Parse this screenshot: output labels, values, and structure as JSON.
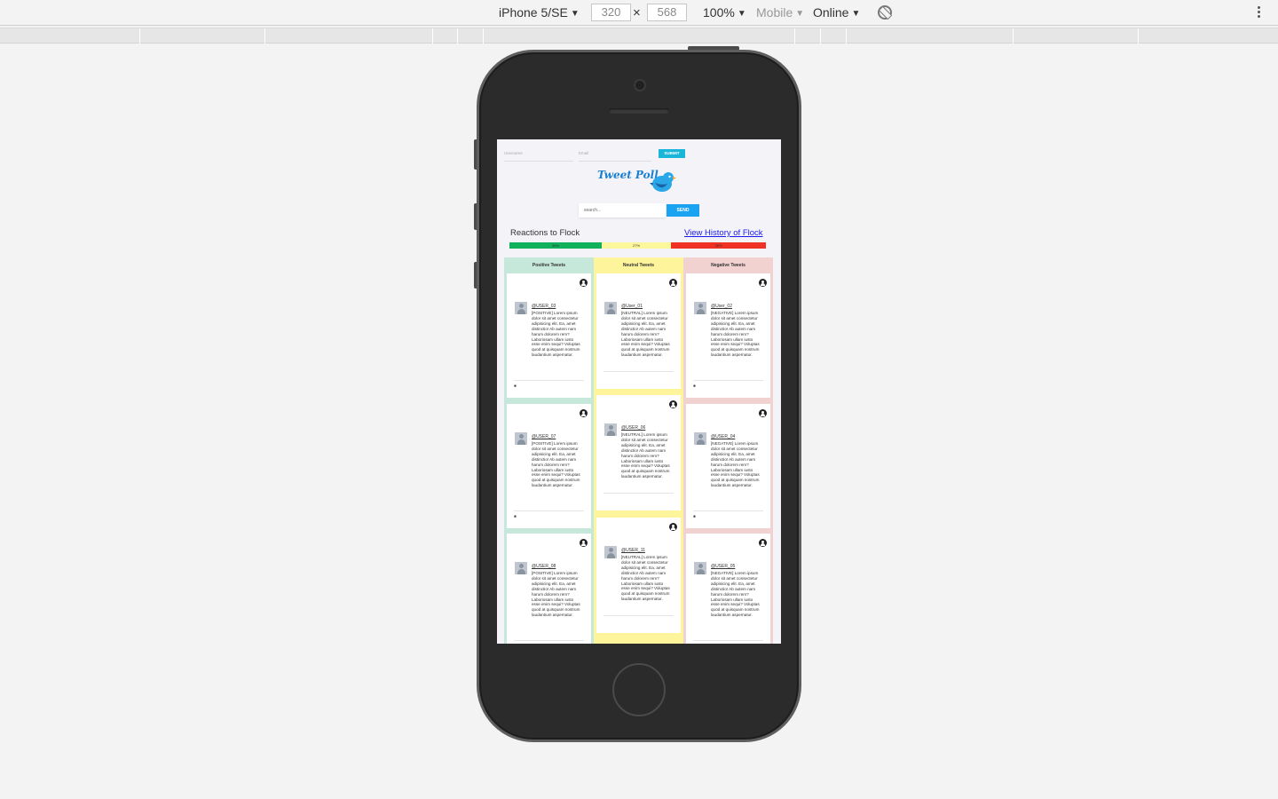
{
  "devtools": {
    "device": "iPhone 5/SE",
    "width": "320",
    "height": "568",
    "times": "×",
    "zoom": "100%",
    "type": "Mobile",
    "network": "Online",
    "caret": "▼"
  },
  "app": {
    "username_placeholder": "Username",
    "email_placeholder": "Email",
    "submit_label": "SUBMIT",
    "logo": "Tweet Poll",
    "search_placeholder": "search...",
    "send_label": "SEND",
    "reactions_title": "Reactions to Flock",
    "history_link": "View History of Flock",
    "sentiment": [
      {
        "label": "36%",
        "value": 0.36,
        "color": "#11b05a"
      },
      {
        "label": "27%",
        "value": 0.27,
        "color": "#fdf79b"
      },
      {
        "label": "36%",
        "value": 0.37,
        "color": "#ef3224"
      }
    ],
    "columns": [
      {
        "title": "Positive Tweets",
        "bg": "#c6e8da",
        "cards": [
          {
            "handle": "@USER_03",
            "text": "[POSITIVE] Lorem ipsum dolor sit amet consectetur adipisicing elit. Ea, amet distinctio! Ab autem nam harum dolorem rem? Laboriosam ullam iusto esse enim sequi? Voluptas quod at quisquam nostrum laudantium aspernatur."
          },
          {
            "handle": "@USER_07",
            "text": "[POSITIVE] Lorem ipsum dolor sit amet consectetur adipisicing elit. Ea, amet distinctio! Ab autem nam harum dolorem rem? Laboriosam ullam iusto esse enim sequi? Voluptas quod at quisquam nostrum laudantium aspernatur."
          },
          {
            "handle": "@USER_08",
            "text": "[POSITIVE] Lorem ipsum dolor sit amet consectetur adipisicing elit. Ea, amet distinctio! Ab autem nam harum dolorem rem? Laboriosam ullam iusto esse enim sequi? Voluptas quod at quisquam nostrum laudantium aspernatur."
          }
        ]
      },
      {
        "title": "Neutral Tweets",
        "bg": "#fdf49c",
        "cards": [
          {
            "handle": "@User_01",
            "text": "[NEUTRAL] Lorem ipsum dolor sit amet consectetur adipisicing elit. Ea, amet distinctio! Ab autem nam harum dolorem rem? Laboriosam ullam iusto esse enim sequi? Voluptas quod at quisquam nostrum laudantium aspernatur."
          },
          {
            "handle": "@USER_06",
            "text": "[NEUTRAL] Lorem ipsum dolor sit amet consectetur adipisicing elit. Ea, amet distinctio! Ab autem nam harum dolorem rem? Laboriosam ullam iusto esse enim sequi? Voluptas quod at quisquam nostrum laudantium aspernatur."
          },
          {
            "handle": "@USER_11",
            "text": "[NEUTRAL] Lorem ipsum dolor sit amet consectetur adipisicing elit. Ea, amet distinctio! Ab autem nam harum dolorem rem? Laboriosam ullam iusto esse enim sequi? Voluptas quod at quisquam nostrum laudantium aspernatur."
          }
        ]
      },
      {
        "title": "Negative Tweets",
        "bg": "#f2d1d1",
        "cards": [
          {
            "handle": "@User_02",
            "text": "[NEGATIVE] Lorem ipsum dolor sit amet consectetur adipisicing elit. Ea, amet distinctio! Ab autem nam harum dolorem rem? Laboriosam ullam iusto esse enim sequi? Voluptas quod at quisquam nostrum laudantium aspernatur."
          },
          {
            "handle": "@USER_04",
            "text": "[NEGATIVE] Lorem ipsum dolor sit amet consectetur adipisicing elit. Ea, amet distinctio! Ab autem nam harum dolorem rem? Laboriosam ullam iusto esse enim sequi? Voluptas quod at quisquam nostrum laudantium aspernatur."
          },
          {
            "handle": "@USER_05",
            "text": "[NEGATIVE] Lorem ipsum dolor sit amet consectetur adipisicing elit. Ea, amet distinctio! Ab autem nam harum dolorem rem? Laboriosam ullam iusto esse enim sequi? Voluptas quod at quisquam nostrum laudantium aspernatur."
          }
        ]
      }
    ]
  }
}
